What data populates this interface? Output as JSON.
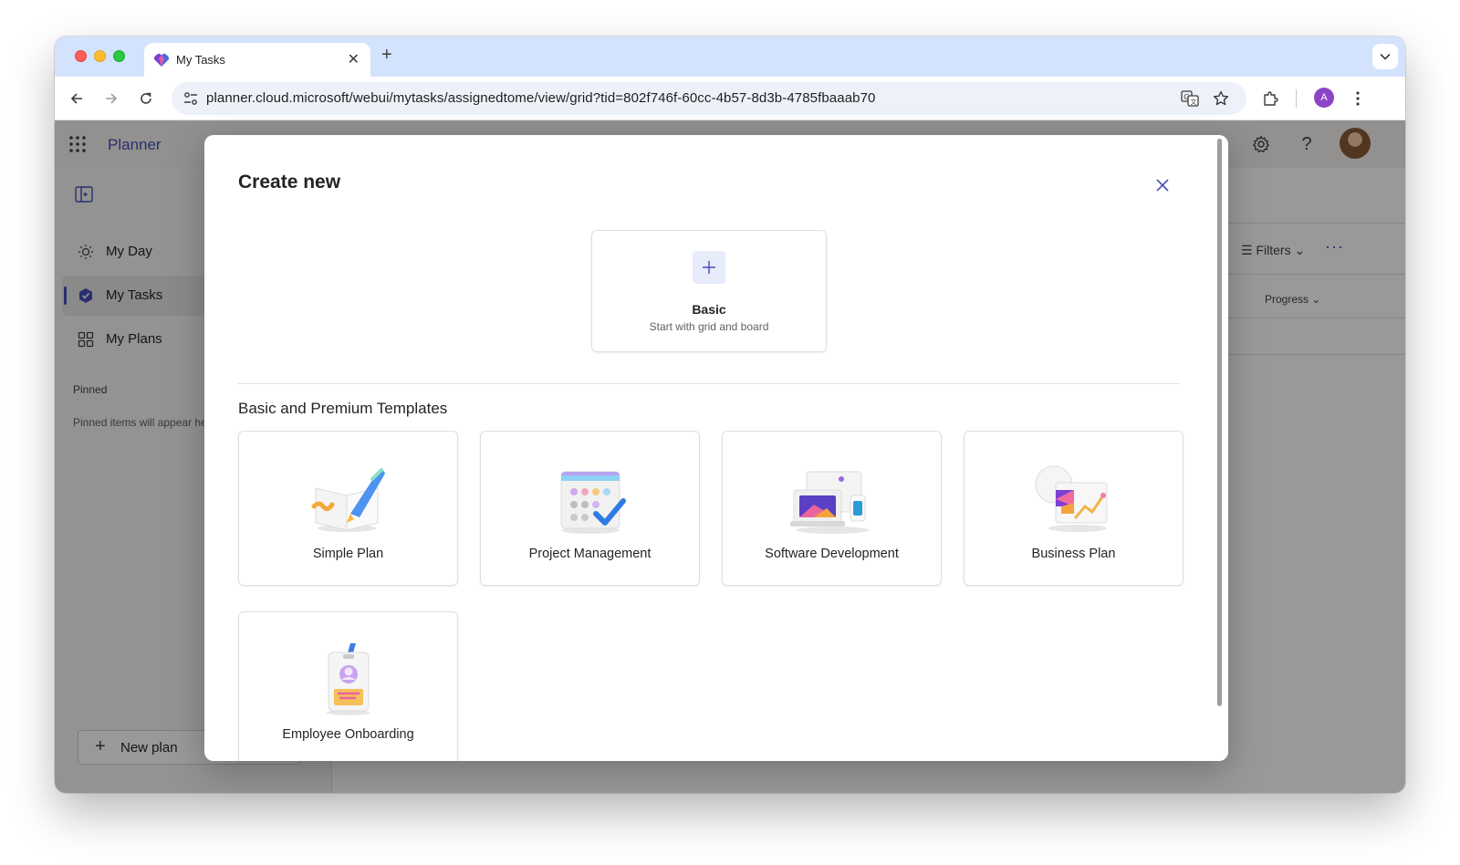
{
  "browser": {
    "tab_title": "My Tasks",
    "url": "planner.cloud.microsoft/webui/mytasks/assignedtome/view/grid?tid=802f746f-60cc-4b57-8d3b-4785fbaaab70",
    "profile_initial": "A"
  },
  "app": {
    "name": "Planner",
    "sidebar": {
      "items": [
        {
          "label": "My Day",
          "icon": "sun-icon"
        },
        {
          "label": "My Tasks",
          "icon": "tasks-icon"
        },
        {
          "label": "My Plans",
          "icon": "grid-icon"
        }
      ],
      "pinned_heading": "Pinned",
      "pinned_empty": "Pinned items will appear here",
      "new_plan_label": "New plan"
    },
    "toolbar": {
      "filters_label": "Filters"
    },
    "grid": {
      "progress_header": "Progress"
    }
  },
  "modal": {
    "title": "Create new",
    "basic": {
      "title": "Basic",
      "subtitle": "Start with grid and board"
    },
    "section_title": "Basic and Premium Templates",
    "templates": [
      {
        "label": "Simple Plan"
      },
      {
        "label": "Project Management"
      },
      {
        "label": "Software Development"
      },
      {
        "label": "Business Plan"
      },
      {
        "label": "Employee Onboarding"
      }
    ]
  },
  "colors": {
    "accent": "#464eb8",
    "tabstrip": "#d3e3fd",
    "overlay": "rgba(0,0,0,0.4)"
  }
}
